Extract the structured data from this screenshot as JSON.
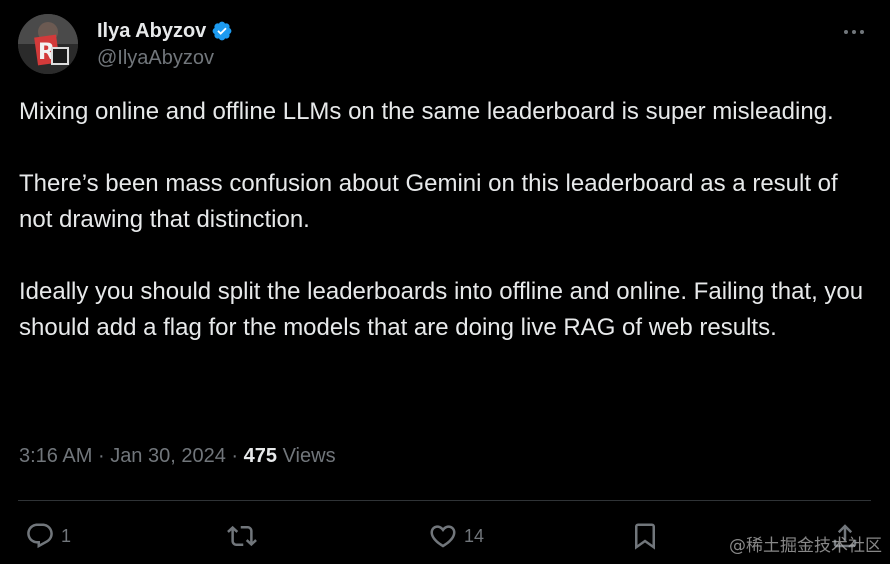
{
  "author": {
    "display_name": "Ilya Abyzov",
    "handle": "@IlyaAbyzov",
    "verified": true
  },
  "tweet": {
    "paragraphs": [
      "Mixing online and offline LLMs on the same leaderboard is super misleading.",
      "There’s been mass confusion about Gemini on this leaderboard as a result of not drawing that distinction.",
      "Ideally you should split the leaderboards into offline and online. Failing that, you should add a flag for the models that are doing live RAG of web results."
    ],
    "time": "3:16 AM",
    "date": "Jan 30, 2024",
    "separator": "·",
    "views_count": "475",
    "views_label": "Views"
  },
  "actions": {
    "reply_count": "1",
    "retweet_count": "",
    "like_count": "14"
  },
  "icons": {
    "more": "more-horizontal-icon",
    "verified": "verified-badge-icon",
    "reply": "reply-icon",
    "retweet": "retweet-icon",
    "like": "heart-icon",
    "bookmark": "bookmark-icon",
    "share": "share-icon"
  },
  "colors": {
    "background": "#000000",
    "text": "#e7e9ea",
    "secondary": "#71767b",
    "verified": "#1d9bf0",
    "divider": "#2f3336"
  },
  "watermark": "@稀土掘金技术社区"
}
